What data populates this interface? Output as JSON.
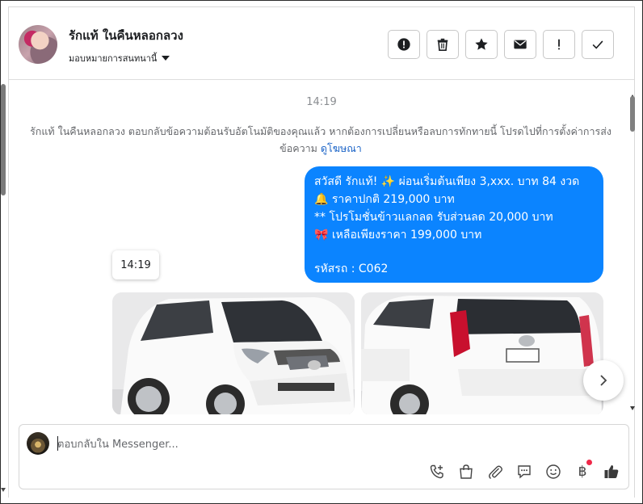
{
  "header": {
    "contact_name": "รักแท้ ในคืนหลอกลวง",
    "assign_label": "มอบหมายการสนทนานี้",
    "actions": [
      {
        "icon": "alert-circle-icon"
      },
      {
        "icon": "trash-icon"
      },
      {
        "icon": "star-icon"
      },
      {
        "icon": "envelope-icon"
      },
      {
        "icon": "exclamation-icon"
      },
      {
        "icon": "check-icon"
      }
    ]
  },
  "thread": {
    "timestamp_top": "14:19",
    "system_message": "รักแท้ ในคืนหลอกลวง ตอบกลับข้อความต้อนรับอัตโนมัติของคุณแล้ว หากต้องการเปลี่ยนหรือลบการทักทายนี้ โปรดไปที่การตั้งค่าการส่งข้อความ",
    "system_link": "ดูโฆษณา",
    "outgoing_bubble": {
      "line1": "สวัสดี รักแท้! ✨  ผ่อนเริ่มต้นเพียง 3,xxx. บาท 84 งวด",
      "line2": "🔔 ราคาปกติ 219,000 บาท",
      "line3": "** โปรโมชั่นข้าวแลกลด รับส่วนลด 20,000 บาท",
      "line4": "🎀  เหลือเพียงราคา 199,000 บาท",
      "line5": "รหัสรถ : C062",
      "color": "#0b84ff"
    },
    "timestamp_pill": "14:19",
    "photos": [
      "white-minivan-front",
      "white-minivan-rear"
    ]
  },
  "composer": {
    "placeholder": "ตอบกลับใน Messenger...",
    "tools": [
      "phone-add-icon",
      "shopping-bag-icon",
      "paperclip-icon",
      "chat-bubble-icon",
      "smiley-icon",
      "baht-icon",
      "thumbs-up-icon"
    ],
    "baht_symbol": "฿"
  }
}
